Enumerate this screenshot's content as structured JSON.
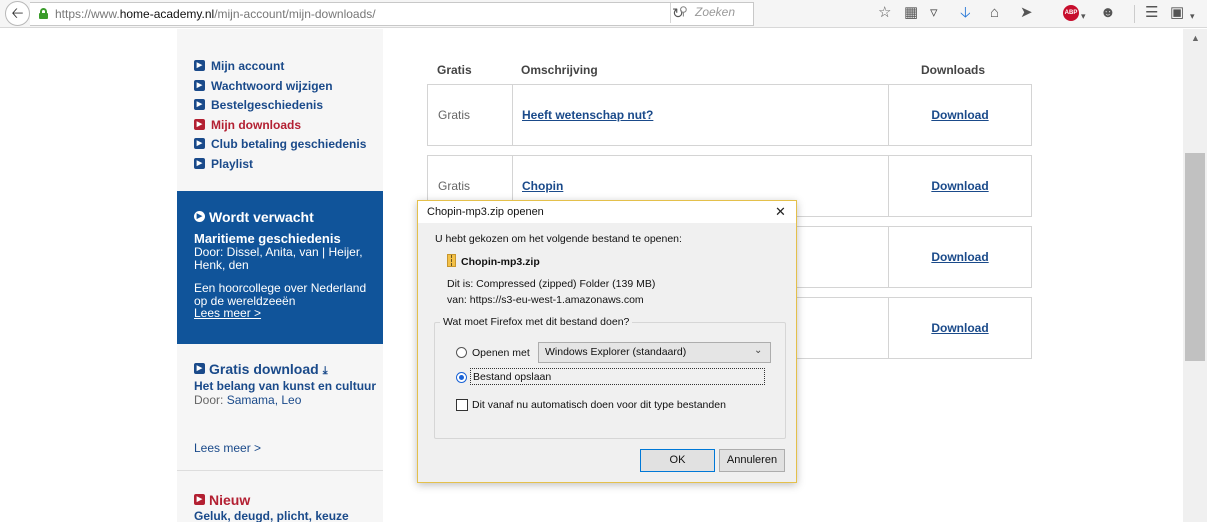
{
  "browser": {
    "url_prefix": "https://www.",
    "url_host": "home-academy.nl",
    "url_path": "/mijn-account/mijn-downloads/",
    "search_placeholder": "Zoeken"
  },
  "sidebar": {
    "menu": [
      {
        "label": "Mijn account"
      },
      {
        "label": "Wachtwoord wijzigen"
      },
      {
        "label": "Bestelgeschiedenis"
      },
      {
        "label": "Mijn downloads"
      },
      {
        "label": "Club betaling geschiedenis"
      },
      {
        "label": "Playlist"
      }
    ],
    "expect": {
      "title": "Wordt verwacht",
      "subtitle": "Maritieme geschiedenis",
      "author": "Door: Dissel, Anita, van | Heijer, Henk, den",
      "description": "Een hoorcollege over Nederland op de wereldzeeën",
      "link": "Lees meer >"
    },
    "gratis": {
      "title": "Gratis download",
      "subtitle": "Het belang van kunst en cultuur",
      "author_prefix": "Door: ",
      "author_name": "Samama, Leo",
      "link": "Lees meer >"
    },
    "nieuw": {
      "title": "Nieuw",
      "subtitle": "Geluk, deugd, plicht, keuze"
    }
  },
  "table": {
    "headers": {
      "price": "Gratis",
      "description": "Omschrijving",
      "downloads": "Downloads"
    },
    "rows": [
      {
        "price": "Gratis",
        "title": "Heeft wetenschap nut?",
        "action": "Download"
      },
      {
        "price": "Gratis",
        "title": "Chopin",
        "action": "Download"
      },
      {
        "price": "",
        "title": "",
        "action": "Download"
      },
      {
        "price": "",
        "title": "",
        "action": "Download"
      }
    ]
  },
  "dialog": {
    "title": "Chopin-mp3.zip openen",
    "intro": "U hebt gekozen om het volgende bestand te openen:",
    "file_name": "Chopin-mp3.zip",
    "file_type": "Dit is:  Compressed (zipped) Folder (139 MB)",
    "file_source": "van:  https://s3-eu-west-1.amazonaws.com",
    "question": "Wat moet Firefox met dit bestand doen?",
    "open_with_label": "Openen met",
    "open_with_value": "Windows Explorer (standaard)",
    "save_label": "Bestand opslaan",
    "auto_label": "Dit vanaf nu automatisch doen voor dit type bestanden",
    "ok_label": "OK",
    "cancel_label": "Annuleren"
  }
}
